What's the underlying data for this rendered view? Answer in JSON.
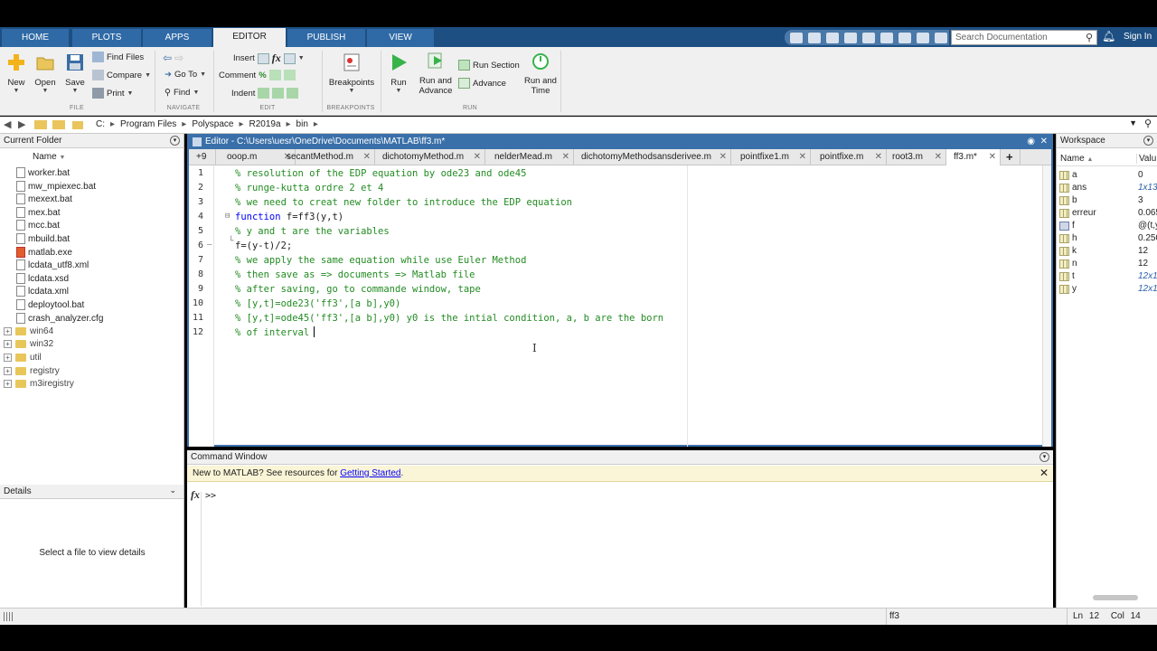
{
  "toolstrip_tabs": [
    "HOME",
    "PLOTS",
    "APPS",
    "EDITOR",
    "PUBLISH",
    "VIEW"
  ],
  "active_tab": "EDITOR",
  "search": {
    "placeholder": "Search Documentation"
  },
  "sign_in": "Sign In",
  "ribbon": {
    "file": {
      "new": "New",
      "open": "Open",
      "save": "Save",
      "find_files": "Find Files",
      "compare": "Compare",
      "print": "Print",
      "group": "FILE"
    },
    "navigate": {
      "go_to": "Go To",
      "find": "Find",
      "group": "NAVIGATE"
    },
    "edit": {
      "insert": "Insert",
      "comment": "Comment",
      "indent": "Indent",
      "group": "EDIT"
    },
    "breakpoints": {
      "label": "Breakpoints",
      "group": "BREAKPOINTS"
    },
    "run": {
      "run": "Run",
      "run_advance": "Run and Advance",
      "run_section": "Run Section",
      "advance": "Advance",
      "run_time": "Run and Time",
      "group": "RUN"
    }
  },
  "address": {
    "segments": [
      "C:",
      "Program Files",
      "Polyspace",
      "R2019a",
      "bin"
    ]
  },
  "current_folder": {
    "title": "Current Folder",
    "column": "Name",
    "files": [
      "worker.bat",
      "mw_mpiexec.bat",
      "mexext.bat",
      "mex.bat",
      "mcc.bat",
      "mbuild.bat",
      "matlab.exe",
      "lcdata_utf8.xml",
      "lcdata.xsd",
      "lcdata.xml",
      "deploytool.bat",
      "crash_analyzer.cfg"
    ],
    "folders": [
      "win64",
      "win32",
      "util",
      "registry",
      "m3iregistry"
    ]
  },
  "details": {
    "title": "Details",
    "message": "Select a file to view details"
  },
  "editor": {
    "title": "Editor - C:\\Users\\uesr\\OneDrive\\Documents\\MATLAB\\ff3.m*",
    "tabs": [
      "ooop.m",
      "secantMethod.m",
      "dichotomyMethod.m",
      "nelderMead.m",
      "dichotomyMethodsansderivee.m",
      "pointfixe1.m",
      "pointfixe.m",
      "root3.m",
      "ff3.m*"
    ],
    "lines": [
      "% resolution of the EDP equation by ode23 and ode45",
      "% runge-kutta ordre 2 et 4",
      "% we need to creat new folder to introduce the EDP equation",
      "function f=ff3(y,t)",
      "% y and t are the variables",
      "f=(y-t)/2;",
      "% we apply the same equation while use Euler Method",
      "% then save as => documents => Matlab file",
      "% after saving, go to commande window, tape",
      "% [y,t]=ode23('ff3',[a b],y0)",
      "% [y,t]=ode45('ff3',[a b],y0) y0 is the intial condition, a, b are the born",
      "% of interval"
    ],
    "keyword_function": "function",
    "line4_rest": " f=ff3(y,t)"
  },
  "command_window": {
    "title": "Command Window",
    "banner": "New to MATLAB? See resources for ",
    "banner_link": "Getting Started",
    "banner_end": ".",
    "fx": "fx",
    "prompt": ">>"
  },
  "workspace": {
    "title": "Workspace",
    "col_name": "Name",
    "col_value": "Valu",
    "vars": [
      {
        "name": "a",
        "value": "0",
        "italic": false
      },
      {
        "name": "ans",
        "value": "1x13",
        "italic": true
      },
      {
        "name": "b",
        "value": "3",
        "italic": false
      },
      {
        "name": "erreur",
        "value": "0.065",
        "italic": false
      },
      {
        "name": "f",
        "value": "@(t,y",
        "italic": false
      },
      {
        "name": "h",
        "value": "0.250",
        "italic": false
      },
      {
        "name": "k",
        "value": "12",
        "italic": false
      },
      {
        "name": "n",
        "value": "12",
        "italic": false
      },
      {
        "name": "t",
        "value": "12x1",
        "italic": true
      },
      {
        "name": "y",
        "value": "12x1",
        "italic": true
      }
    ]
  },
  "status": {
    "file": "ff3",
    "ln_label": "Ln",
    "ln": "12",
    "col_label": "Col",
    "col": "14"
  },
  "colors": {
    "comment": "#228b22",
    "keyword": "#0000ff",
    "tabbar": "#1d4f83",
    "editor_border": "#3a70a9"
  }
}
